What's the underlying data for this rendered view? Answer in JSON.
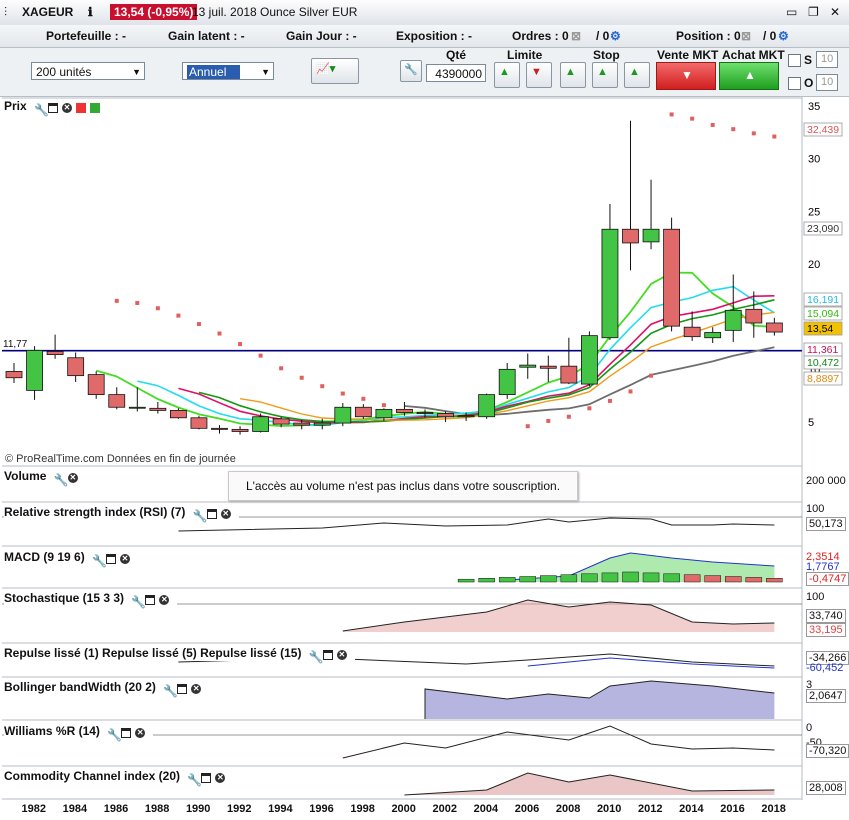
{
  "header": {
    "symbol": "XAGEUR",
    "price_change": "13,54 (-0,95%)",
    "date_name": "13 juil. 2018 Ounce Silver EUR"
  },
  "status": {
    "portefeuille": "Portefeuille : -",
    "gain_latent": "Gain latent : -",
    "gain_jour": "Gain Jour : -",
    "exposition": "Exposition : -",
    "ordres": "Ordres : 0",
    "ordres_count": "/ 0",
    "position": "Position : 0",
    "position_count": "/ 0"
  },
  "order": {
    "quantity_select": "200 unités",
    "period_select": "Annuel",
    "qte_label": "Qté",
    "qte_value": "4390000",
    "limite_label": "Limite",
    "stop_label": "Stop",
    "vente_label": "Vente MKT",
    "achat_label": "Achat MKT",
    "s_label": "S",
    "o_label": "O",
    "s_value": "10",
    "o_value": "10"
  },
  "panels": {
    "prix": "Prix",
    "volume": "Volume",
    "volume_message": "L'accès au volume n'est pas inclus dans votre souscription.",
    "volume_axis": "200 000",
    "rsi": "Relative strength index (RSI) (7)",
    "macd": "MACD (9 19 6)",
    "stochastic": "Stochastique (15 3 3)",
    "repulse": "Repulse lissé (1) Repulse lissé (5) Repulse lissé (15)",
    "bollinger": "Bollinger bandWidth (20 2)",
    "williams": "Williams %R (14)",
    "cci": "Commodity Channel index (20)",
    "watermark": "© ProRealTime.com  Données en fin de journée",
    "hline_label": "11,77"
  },
  "colors": {
    "up": "#44c444",
    "down": "#e06a6a",
    "sma_gray": "#6e6e6e",
    "ma_green": "#44dd22",
    "ma_cyan": "#22ddee",
    "ma_magenta": "#dd1166",
    "ma_darkgreen": "#119911",
    "ma_orange": "#f09a1a",
    "sar": "#e06060",
    "hline": "#000080"
  },
  "chart_data": {
    "type": "candlestick",
    "x": [
      1981,
      1982,
      1983,
      1984,
      1985,
      1986,
      1987,
      1988,
      1989,
      1990,
      1991,
      1992,
      1993,
      1994,
      1995,
      1996,
      1997,
      1998,
      1999,
      2000,
      2001,
      2002,
      2003,
      2004,
      2005,
      2006,
      2007,
      2008,
      2009,
      2010,
      2011,
      2012,
      2013,
      2014,
      2015,
      2016,
      2017,
      2018
    ],
    "ohlc": [
      [
        9.8,
        10.6,
        8.7,
        9.2
      ],
      [
        8.0,
        12.2,
        7.1,
        11.8
      ],
      [
        11.7,
        13.3,
        11.0,
        11.4
      ],
      [
        11.1,
        11.6,
        8.8,
        9.4
      ],
      [
        9.5,
        9.8,
        7.2,
        7.6
      ],
      [
        7.6,
        8.3,
        6.2,
        6.4
      ],
      [
        6.4,
        8.3,
        6.0,
        6.4
      ],
      [
        6.3,
        6.9,
        5.8,
        6.1
      ],
      [
        6.1,
        6.3,
        5.3,
        5.4
      ],
      [
        5.4,
        5.6,
        4.3,
        4.4
      ],
      [
        4.4,
        4.7,
        3.9,
        4.3
      ],
      [
        4.3,
        4.6,
        3.8,
        4.1
      ],
      [
        4.1,
        5.8,
        4.0,
        5.5
      ],
      [
        5.3,
        5.5,
        4.5,
        4.8
      ],
      [
        4.9,
        5.2,
        4.3,
        4.7
      ],
      [
        4.7,
        5.3,
        4.3,
        4.9
      ],
      [
        4.9,
        6.8,
        4.6,
        6.4
      ],
      [
        6.4,
        6.7,
        5.3,
        5.5
      ],
      [
        5.4,
        6.3,
        5.1,
        6.2
      ],
      [
        6.2,
        6.9,
        5.6,
        5.9
      ],
      [
        5.9,
        6.2,
        5.4,
        5.8
      ],
      [
        5.8,
        6.0,
        5.0,
        5.5
      ],
      [
        5.5,
        5.9,
        5.1,
        5.6
      ],
      [
        5.5,
        7.7,
        5.3,
        7.6
      ],
      [
        7.6,
        10.6,
        7.2,
        10.0
      ],
      [
        10.2,
        11.5,
        9.1,
        10.4
      ],
      [
        10.3,
        11.3,
        8.8,
        10.1
      ],
      [
        10.3,
        13.0,
        8.6,
        8.7
      ],
      [
        8.6,
        13.6,
        8.4,
        13.2
      ],
      [
        13.0,
        25.7,
        12.8,
        23.3
      ],
      [
        23.3,
        33.6,
        19.4,
        22.0
      ],
      [
        22.1,
        28.0,
        21.4,
        23.3
      ],
      [
        23.3,
        24.4,
        13.6,
        14.1
      ],
      [
        14.0,
        15.5,
        12.7,
        13.1
      ],
      [
        13.0,
        14.0,
        12.5,
        13.5
      ],
      [
        13.7,
        19.0,
        12.6,
        15.6
      ],
      [
        15.7,
        17.4,
        13.0,
        14.4
      ],
      [
        14.4,
        14.9,
        13.2,
        13.54
      ]
    ],
    "price_scale": [
      5,
      10,
      15,
      20,
      25,
      30,
      35
    ],
    "last_values": {
      "sar": "32,439",
      "sma_gray": "23,090",
      "ma_cyan": "16,191",
      "ma_green": "15,094",
      "price": "13,54",
      "ma_magenta": "11,361",
      "ma_darkgreen": "10,472",
      "ma_orange": "8,8897"
    },
    "ylim": [
      2,
      36
    ],
    "indicators": {
      "rsi": {
        "axis": "100",
        "value": "50,173"
      },
      "macd": {
        "v1": "2,3514",
        "v2": "1,7767",
        "v3": "-0,4747"
      },
      "stochastic": {
        "axis": "100",
        "v1": "33,740",
        "v2": "33,195"
      },
      "repulse": {
        "v1": "-34,266",
        "v2": "-60,452"
      },
      "bollinger": {
        "axis": "3",
        "value": "2,0647"
      },
      "williams": {
        "axis": "0",
        "axis2": "-50",
        "value": "-70,320"
      },
      "cci": {
        "value": "28,008"
      }
    },
    "x_ticks": [
      "1982",
      "1984",
      "1986",
      "1988",
      "1990",
      "1992",
      "1994",
      "1996",
      "1998",
      "2000",
      "2002",
      "2004",
      "2006",
      "2008",
      "2010",
      "2012",
      "2014",
      "2016",
      "2018"
    ]
  }
}
